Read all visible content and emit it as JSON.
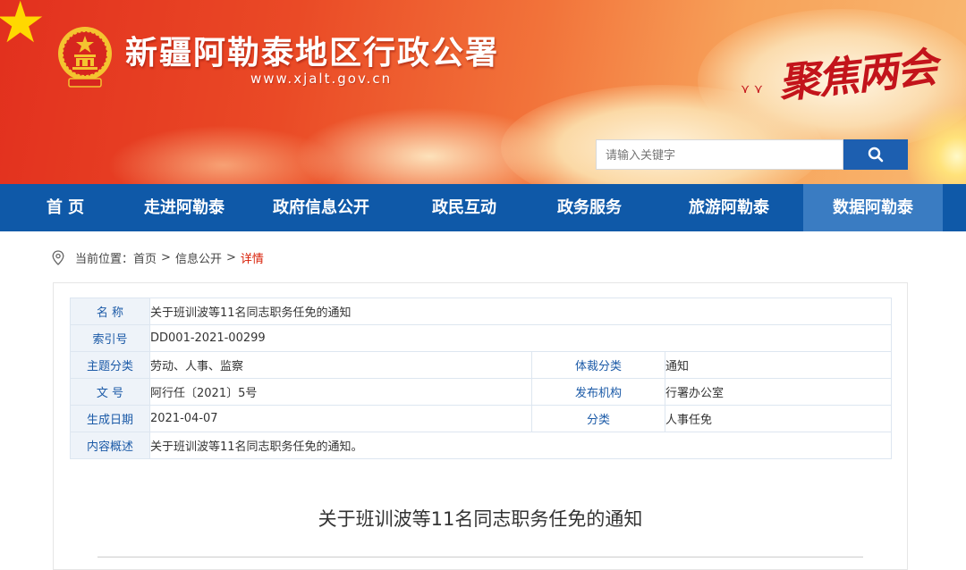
{
  "header": {
    "site_title": "新疆阿勒泰地区行政公署",
    "site_url": "www.xjalt.gov.cn",
    "slogan": "聚焦两会"
  },
  "search": {
    "placeholder": "请输入关键字"
  },
  "nav": {
    "items": [
      {
        "label": "首 页"
      },
      {
        "label": "走进阿勒泰"
      },
      {
        "label": "政府信息公开"
      },
      {
        "label": "政民互动"
      },
      {
        "label": "政务服务"
      },
      {
        "label": "旅游阿勒泰"
      },
      {
        "label": "数据阿勒泰"
      }
    ]
  },
  "breadcrumb": {
    "prefix": "当前位置：",
    "items": [
      "首页",
      "信息公开",
      "详情"
    ],
    "separator": ">"
  },
  "meta": {
    "name_label": "名 称",
    "name_value": "关于班训波等11名同志职务任免的通知",
    "index_label": "索引号",
    "index_value": "DD001-2021-00299",
    "topic_label": "主题分类",
    "topic_value": "劳动、人事、监察",
    "genre_label": "体裁分类",
    "genre_value": "通知",
    "docno_label": "文 号",
    "docno_value": "阿行任〔2021〕5号",
    "publisher_label": "发布机构",
    "publisher_value": "行署办公室",
    "date_label": "生成日期",
    "date_value": "2021-04-07",
    "category_label": "分类",
    "category_value": "人事任免",
    "summary_label": "内容概述",
    "summary_value": "关于班训波等11名同志职务任免的通知。"
  },
  "document": {
    "title": "关于班训波等11名同志职务任免的通知"
  },
  "colors": {
    "nav_bg": "#0f59a8",
    "nav_active_bg": "#3a7cc2",
    "label_blue": "#1b5aa7",
    "breadcrumb_current": "#d81e06",
    "slogan_red": "#c3141b"
  }
}
